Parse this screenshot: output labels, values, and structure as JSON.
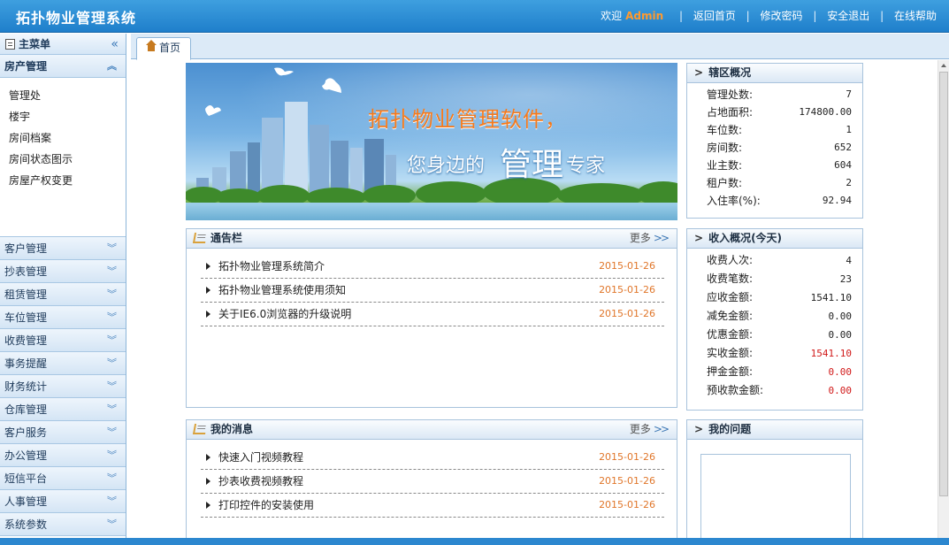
{
  "app": {
    "title": "拓扑物业管理系统"
  },
  "topbar": {
    "welcome": "欢迎",
    "user": "Admin",
    "links": [
      "返回首页",
      "修改密码",
      "安全退出",
      "在线帮助"
    ]
  },
  "sidebar": {
    "header": "主菜单",
    "collapse_glyph": "«",
    "open_group": "房产管理",
    "open_items": [
      "管理处",
      "楼宇",
      "房间档案",
      "房间状态图示",
      "房屋产权变更"
    ],
    "groups": [
      "客户管理",
      "抄表管理",
      "租赁管理",
      "车位管理",
      "收费管理",
      "事务提醒",
      "财务统计",
      "仓库管理",
      "客户服务",
      "办公管理",
      "短信平台",
      "人事管理",
      "系统参数"
    ]
  },
  "tabs": [
    {
      "label": "首页"
    }
  ],
  "banner": {
    "line1": "拓扑物业管理软件，",
    "line2_pre": "您身边的",
    "line2_big": "管理",
    "line2_post": "专家"
  },
  "notice": {
    "title": "通告栏",
    "more": "更多",
    "items": [
      {
        "title": "拓扑物业管理系统简介",
        "date": "2015-01-26"
      },
      {
        "title": "拓扑物业管理系统使用须知",
        "date": "2015-01-26"
      },
      {
        "title": "关于IE6.0浏览器的升级说明",
        "date": "2015-01-26"
      }
    ]
  },
  "messages": {
    "title": "我的消息",
    "more": "更多",
    "items": [
      {
        "title": "快速入门视频教程",
        "date": "2015-01-26"
      },
      {
        "title": "抄表收费视频教程",
        "date": "2015-01-26"
      },
      {
        "title": "打印控件的安装使用",
        "date": "2015-01-26"
      }
    ]
  },
  "district": {
    "title": "辖区概况",
    "rows": [
      {
        "label": "管理处数:",
        "value": "7"
      },
      {
        "label": "占地面积:",
        "value": "174800.00"
      },
      {
        "label": "车位数:",
        "value": "1"
      },
      {
        "label": "房间数:",
        "value": "652"
      },
      {
        "label": "业主数:",
        "value": "604"
      },
      {
        "label": "租户数:",
        "value": "2"
      },
      {
        "label": "入住率(%):",
        "value": "92.94"
      }
    ]
  },
  "income": {
    "title": "收入概况(今天)",
    "rows": [
      {
        "label": "收费人次:",
        "value": "4"
      },
      {
        "label": "收费笔数:",
        "value": "23"
      },
      {
        "label": "应收金额:",
        "value": "1541.10"
      },
      {
        "label": "减免金额:",
        "value": "0.00"
      },
      {
        "label": "优惠金额:",
        "value": "0.00"
      },
      {
        "label": "实收金额:",
        "value": "1541.10"
      },
      {
        "label": "押金金额:",
        "value": "0.00"
      },
      {
        "label": "预收款金额:",
        "value": "0.00"
      }
    ]
  },
  "problems": {
    "title": "我的问题"
  },
  "colors": {
    "topbar": "#1f7fcb",
    "date": "#e0762a",
    "highlight_red": "#d11a1a",
    "username": "#ff9a2e"
  }
}
